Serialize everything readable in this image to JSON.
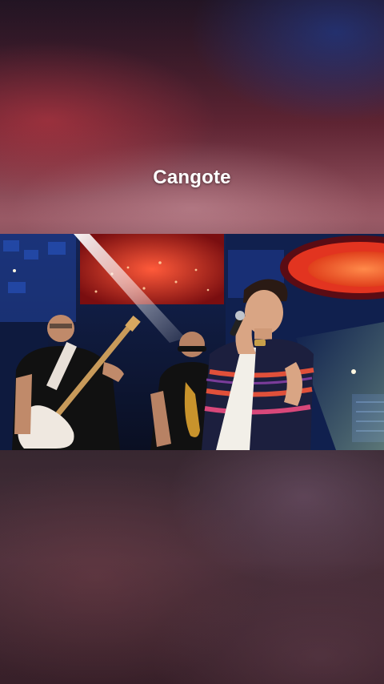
{
  "caption": {
    "text": "Cangote"
  },
  "video": {
    "scene": "stage-performance"
  },
  "colors": {
    "caption_text": "#ffffff",
    "stage_red": "#d8382c",
    "stage_blue": "#1b2b6a"
  }
}
